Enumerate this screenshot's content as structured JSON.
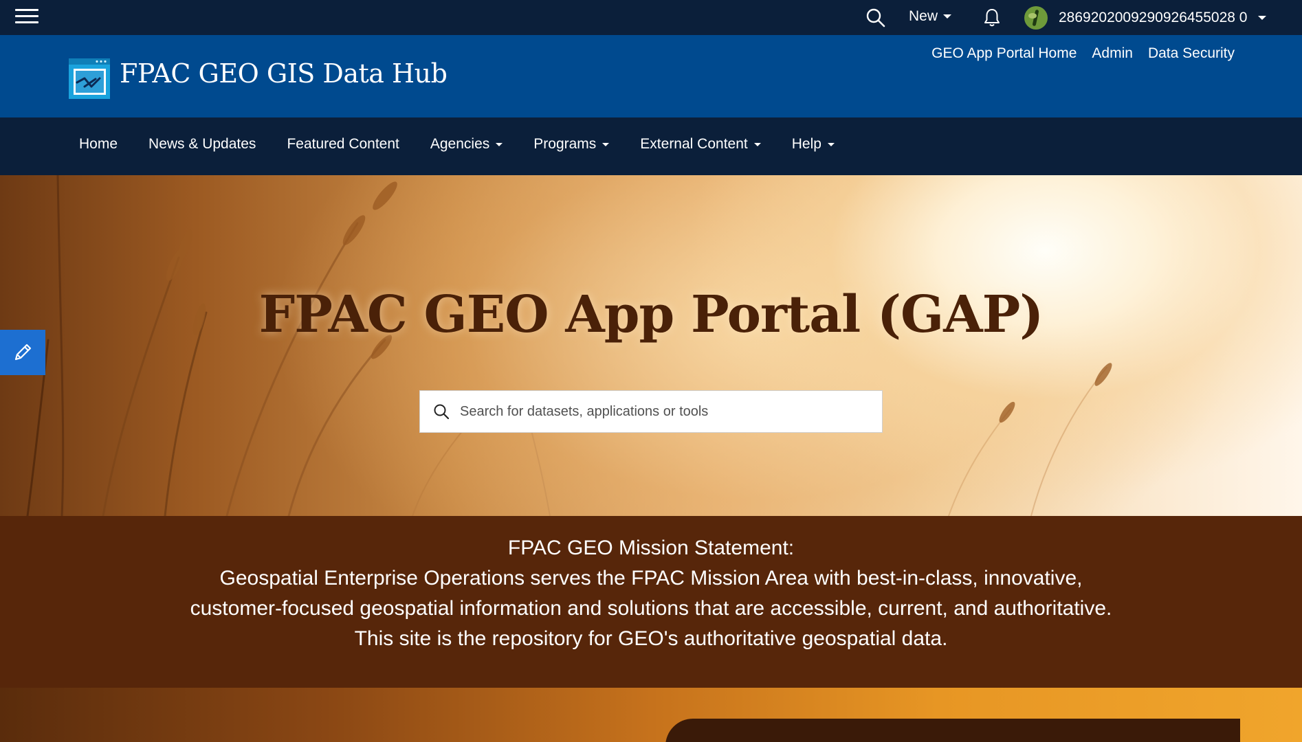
{
  "topbar": {
    "menu_icon": "hamburger-menu-icon",
    "search_icon": "search-icon",
    "new_label": "New",
    "bell_icon": "bell-icon",
    "username": "2869202009290926455028 0"
  },
  "header": {
    "site_title": "FPAC GEO GIS Data Hub",
    "links": [
      "GEO App Portal Home",
      "Admin",
      "Data Security"
    ]
  },
  "nav": {
    "items": [
      {
        "label": "Home",
        "dropdown": false
      },
      {
        "label": "News & Updates",
        "dropdown": false
      },
      {
        "label": "Featured Content",
        "dropdown": false
      },
      {
        "label": "Agencies",
        "dropdown": true
      },
      {
        "label": "Programs",
        "dropdown": true
      },
      {
        "label": "External Content",
        "dropdown": true
      },
      {
        "label": "Help",
        "dropdown": true
      }
    ]
  },
  "hero": {
    "title": "FPAC GEO App Portal (GAP)",
    "search_placeholder": "Search for datasets, applications or tools"
  },
  "mission": {
    "heading": "FPAC GEO Mission Statement:",
    "lines": [
      "Geospatial Enterprise Operations serves the FPAC Mission Area with best-in-class, innovative,",
      "customer-focused geospatial information and solutions that are accessible, current, and authoritative.",
      "This site is the repository for GEO's authoritative geospatial data."
    ]
  },
  "colors": {
    "topbar": "#0b1f3a",
    "header": "#004a8f",
    "mission_bg": "#57260a",
    "hero_title": "#4a2108",
    "edit_tab": "#1d6fd1"
  }
}
